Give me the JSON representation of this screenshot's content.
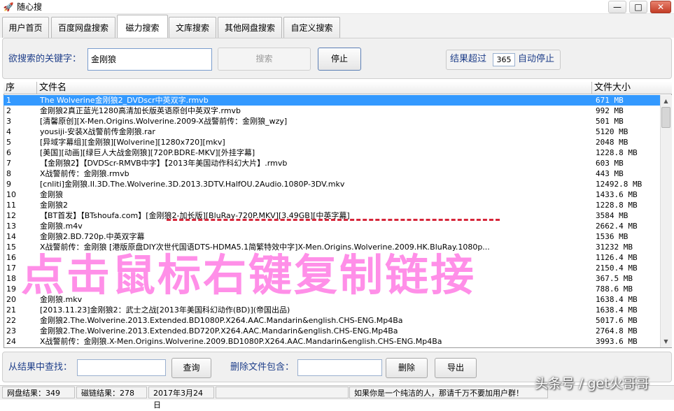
{
  "window": {
    "title": "随心搜",
    "icon": "rocket-icon",
    "controls": {
      "minimize": "—",
      "maximize": "□",
      "close": "✕"
    }
  },
  "tabs": [
    {
      "label": "用户首页"
    },
    {
      "label": "百度网盘搜索"
    },
    {
      "label": "磁力搜索"
    },
    {
      "label": "文库搜索"
    },
    {
      "label": "其他网盘搜索"
    },
    {
      "label": "自定义搜索"
    }
  ],
  "search": {
    "keyword_label": "欲搜索的关键字：",
    "keyword_value": "金刚狼",
    "search_button": "搜索",
    "stop_button": "停止",
    "limit_prefix": "结果超过",
    "limit_value": "365",
    "limit_suffix": "自动停止"
  },
  "table": {
    "columns": [
      "序",
      "文件名",
      "文件大小"
    ],
    "selected_index": 0,
    "rows": [
      {
        "idx": "1",
        "name": "The Wolverine金刚狼2_DVDscr中英双字.rmvb",
        "size": "671 MB"
      },
      {
        "idx": "2",
        "name": "金刚狼2真正蓝光1280高清加长版英语原创中英双字.rmvb",
        "size": "992 MB"
      },
      {
        "idx": "3",
        "name": "[清馨原创][X-Men.Origins.Wolverine.2009-X战警前传：金刚狼_wzy]",
        "size": "501 MB"
      },
      {
        "idx": "4",
        "name": "yousiji-安装X战警前传金刚狼.rar",
        "size": "5120 MB"
      },
      {
        "idx": "5",
        "name": "[异域字幕组][金刚狼][Wolverine][1280x720][mkv]",
        "size": "2048 MB"
      },
      {
        "idx": "6",
        "name": "[美国][动画][绿巨人大战金刚狼][720P.BDRE-MKV][外挂字幕]",
        "size": "1228.8 MB"
      },
      {
        "idx": "7",
        "name": "【金刚狼2】【DVDScr-RMVB中字】【2013年美国动作科幻大片】.rmvb",
        "size": "603 MB"
      },
      {
        "idx": "8",
        "name": "X战警前传：金刚狼.rmvb",
        "size": "443 MB"
      },
      {
        "idx": "9",
        "name": "[cnliti]金刚狼.II.3D.The.Wolverine.3D.2013.3DTV.HalfOU.2Audio.1080P-3DV.mkv",
        "size": "12492.8 MB"
      },
      {
        "idx": "10",
        "name": "金刚狼",
        "size": "1433.6 MB"
      },
      {
        "idx": "11",
        "name": "金刚狼2",
        "size": "1228.8 MB"
      },
      {
        "idx": "12",
        "name": "【BT首发】【BTshoufa.com】[金刚狼2-加长版][BluRay-720P.MKV][3.49GB][中英字幕]",
        "size": "3584 MB"
      },
      {
        "idx": "13",
        "name": "金刚狼.m4v",
        "size": "2662.4 MB"
      },
      {
        "idx": "14",
        "name": "金刚狼2.BD.720p.中英双字幕",
        "size": "1536 MB"
      },
      {
        "idx": "15",
        "name": "X战警前传：金刚狼 [港版原盘DIY次世代国语DTS-HDMA5.1简繁特效中字]X-Men.Origins.Wolverine.2009.HK.BluRay.1080p...",
        "size": "31232 MB"
      },
      {
        "idx": "16",
        "name": "",
        "size": "1126.4 MB"
      },
      {
        "idx": "17",
        "name": "",
        "size": "2150.4 MB"
      },
      {
        "idx": "18",
        "name": "",
        "size": "367.5 MB"
      },
      {
        "idx": "19",
        "name": "",
        "size": "788.6 MB"
      },
      {
        "idx": "20",
        "name": "金刚狼.mkv",
        "size": "1638.4 MB"
      },
      {
        "idx": "21",
        "name": "[2013.11.23]金刚狼2：武士之战[2013年美国科幻动作(BD)](帝国出品)",
        "size": "1638.4 MB"
      },
      {
        "idx": "22",
        "name": "金刚狼2.The.Wolverine.2013.Extended.BD1080P.X264.AAC.Mandarin&english.CHS-ENG.Mp4Ba",
        "size": "5017.6 MB"
      },
      {
        "idx": "23",
        "name": "金刚狼2.The.Wolverine.2013.Extended.BD720P.X264.AAC.Mandarin&english.CHS-ENG.Mp4Ba",
        "size": "2764.8 MB"
      },
      {
        "idx": "24",
        "name": "X战警前传：金刚狼.X-Men.Origins.Wolverine.2009.BD1080P.X264.AAC.Mandarin&english.CHS-ENG.Mp4Ba",
        "size": "3993.6 MB"
      }
    ]
  },
  "overlay": {
    "caption": "点击鼠标右键复制链接",
    "caption_color": "#ff8fe8",
    "underline_color": "#d6263a"
  },
  "filter": {
    "find_label": "从结果中查找：",
    "find_value": "",
    "query_button": "查询",
    "delete_label": "删除文件包含：",
    "delete_value": "",
    "delete_button": "删除",
    "export_button": "导出"
  },
  "status": {
    "netdisk": "网盘结果：349",
    "magnet": "磁链结果：278",
    "date": "2017年3月24日",
    "blank": "",
    "message": "如果你是一个纯洁的人，那请千万不要加用户群！"
  },
  "watermark": {
    "text": "头条号 / get火哥哥"
  },
  "colors": {
    "selection": "#3399ff",
    "label_blue": "#1f3f8a",
    "close_red": "#c33d26"
  }
}
